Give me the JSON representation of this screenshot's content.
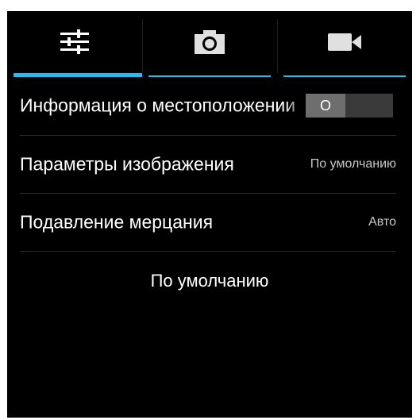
{
  "tabs": [
    {
      "icon": "sliders-icon",
      "active": true
    },
    {
      "icon": "camera-icon",
      "active": false
    },
    {
      "icon": "video-camera-icon",
      "active": false
    }
  ],
  "settings": [
    {
      "label": "Информация о местоположении",
      "toggle": "O"
    },
    {
      "label": "Параметры изображения",
      "value": "По умолчанию"
    },
    {
      "label": "Подавление мерцания",
      "value": "Авто"
    }
  ],
  "reset_label": "По умолчанию",
  "colors": {
    "accent": "#33b5e5",
    "background": "#000000",
    "text": "#ffffff"
  }
}
